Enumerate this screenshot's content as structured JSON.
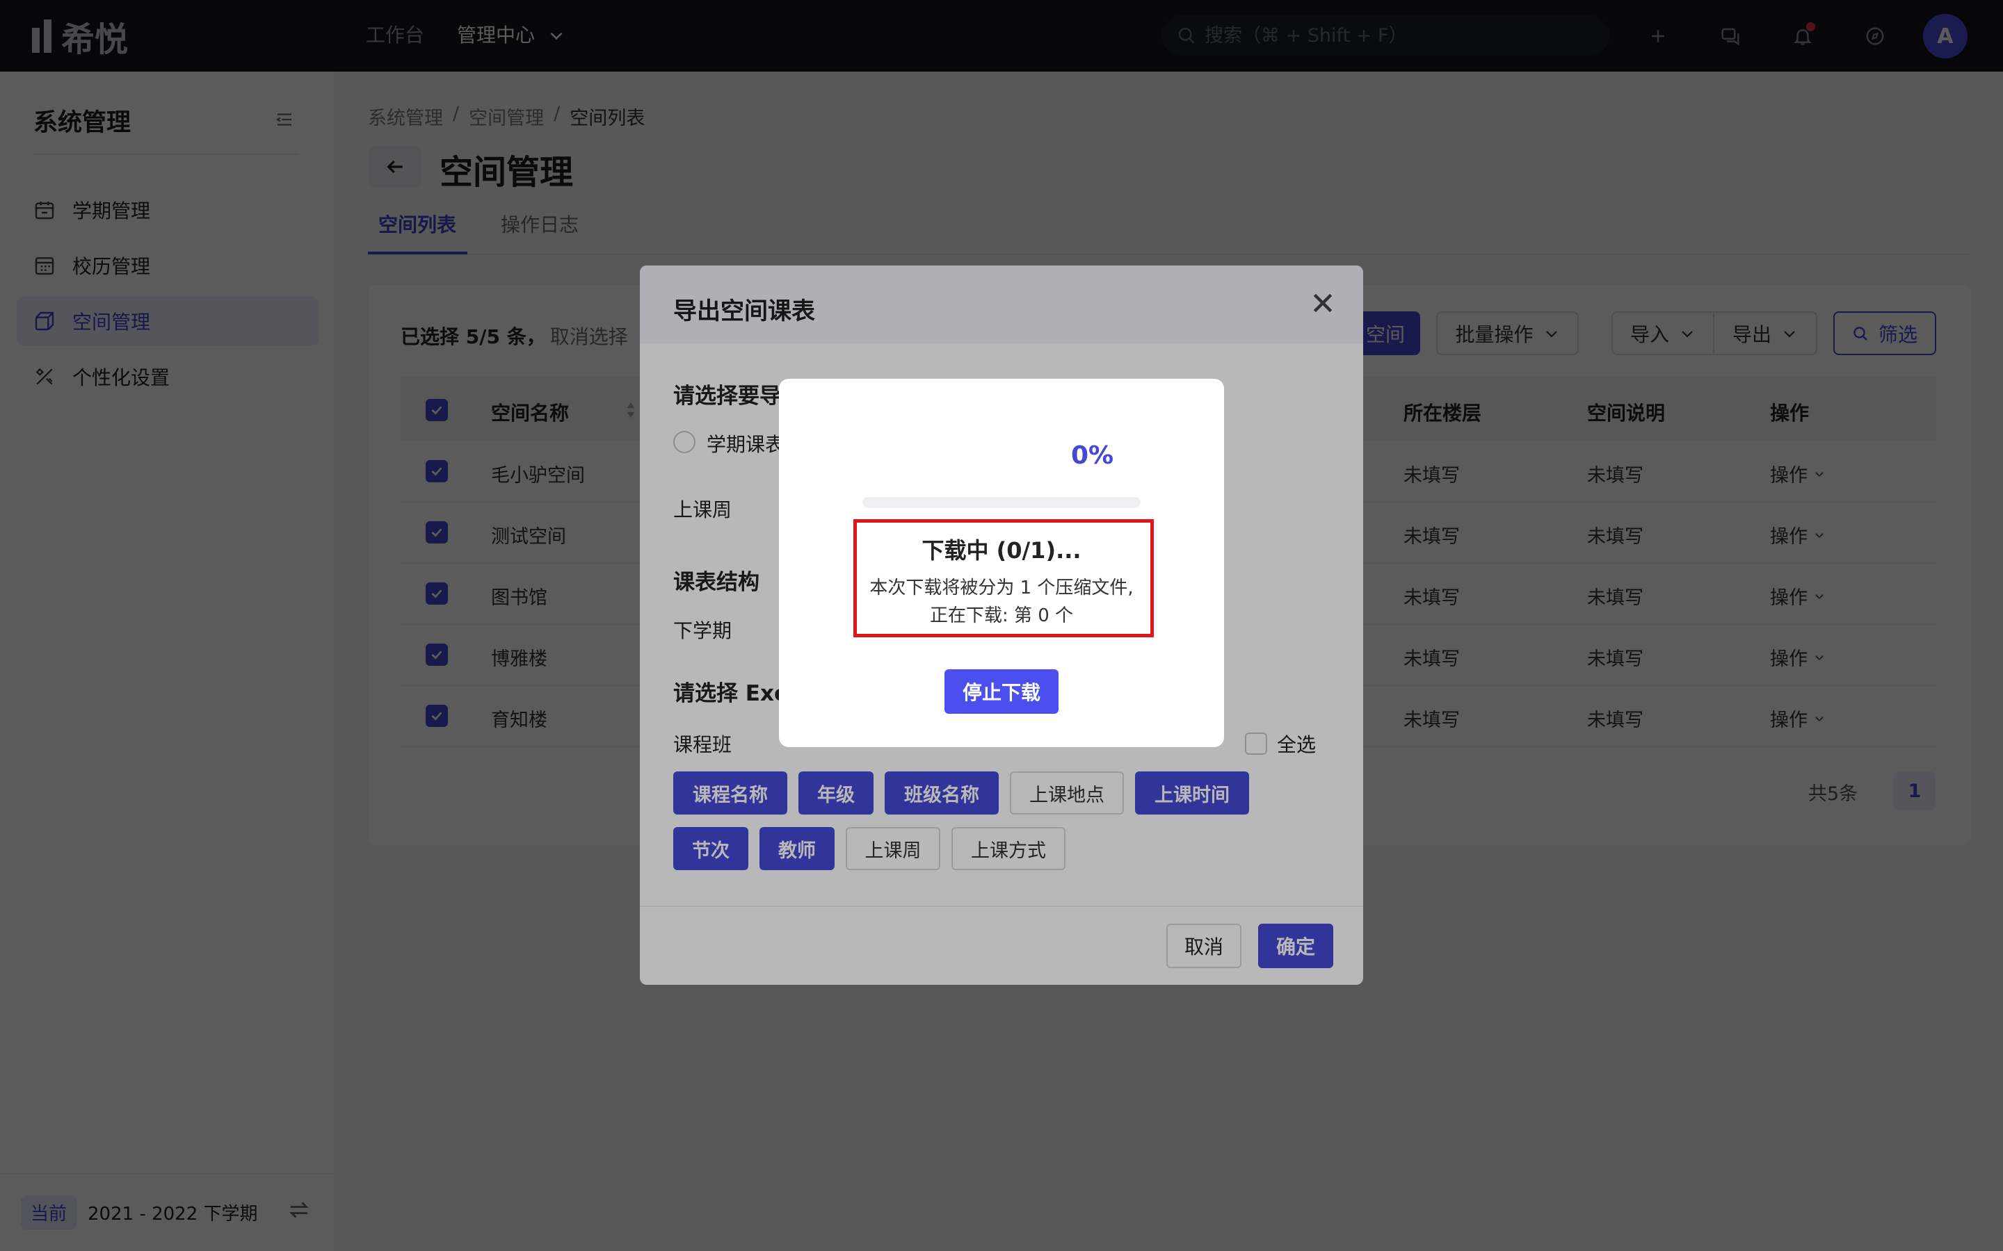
{
  "brand": {
    "name": "希悦"
  },
  "topbar": {
    "workbench": "工作台",
    "admin": "管理中心",
    "search_placeholder": "搜索（⌘ + Shift + F）",
    "avatar": "A"
  },
  "sidebar": {
    "title": "系统管理",
    "items": [
      {
        "label": "学期管理"
      },
      {
        "label": "校历管理"
      },
      {
        "label": "空间管理"
      },
      {
        "label": "个性化设置"
      }
    ],
    "period_badge": "当前",
    "period_value": "2021 - 2022 下学期"
  },
  "breadcrumb": [
    "系统管理",
    "/",
    "空间管理",
    "/",
    "空间列表"
  ],
  "page_title": "空间管理",
  "tabs": [
    "空间列表",
    "操作日志"
  ],
  "toolbar": {
    "selected": "已选择 5/5 条，",
    "cancel_select": "取消选择",
    "add_space": "空间",
    "batch": "批量操作",
    "import": "导入",
    "export": "导出",
    "filter": "筛选"
  },
  "table": {
    "headers": {
      "name": "空间名称",
      "floor": "所在楼层",
      "desc": "空间说明",
      "op": "操作"
    },
    "rows": [
      {
        "name": "毛小驴空间",
        "floor": "未填写",
        "desc": "未填写",
        "op": "操作"
      },
      {
        "name": "测试空间",
        "floor": "未填写",
        "desc": "未填写",
        "op": "操作"
      },
      {
        "name": "图书馆",
        "floor": "未填写",
        "desc": "未填写",
        "op": "操作"
      },
      {
        "name": "博雅楼",
        "floor": "未填写",
        "desc": "未填写",
        "op": "操作"
      },
      {
        "name": "育知楼",
        "floor": "未填写",
        "desc": "未填写",
        "op": "操作"
      }
    ],
    "total": "共5条",
    "page": "1"
  },
  "dialog": {
    "title": "导出空间课表",
    "select_label": "请选择要导",
    "term_option": "学期课表",
    "week_label": "上课周",
    "structure_label": "课表结构",
    "term_value": "下学期",
    "excel_label": "请选择 Exc",
    "class_label": "课程班",
    "select_all": "全选",
    "chips": [
      {
        "label": "课程名称",
        "on": true
      },
      {
        "label": "年级",
        "on": true
      },
      {
        "label": "班级名称",
        "on": true
      },
      {
        "label": "上课地点",
        "on": false
      },
      {
        "label": "上课时间",
        "on": true
      },
      {
        "label": "节次",
        "on": true
      },
      {
        "label": "教师",
        "on": true
      },
      {
        "label": "上课周",
        "on": false
      },
      {
        "label": "上课方式",
        "on": false
      }
    ],
    "cancel": "取消",
    "ok": "确定"
  },
  "progress": {
    "percent_text": "0%",
    "percent": 0,
    "status": "下载中 (0/1)...",
    "desc_line1": "本次下载将被分为 1 个压缩文件,",
    "desc_line2": "正在下载: 第 0 个",
    "stop": "停止下载"
  },
  "colors": {
    "accent": "#4548d4",
    "highlight": "#e0141e",
    "topbar": "#16171d"
  }
}
